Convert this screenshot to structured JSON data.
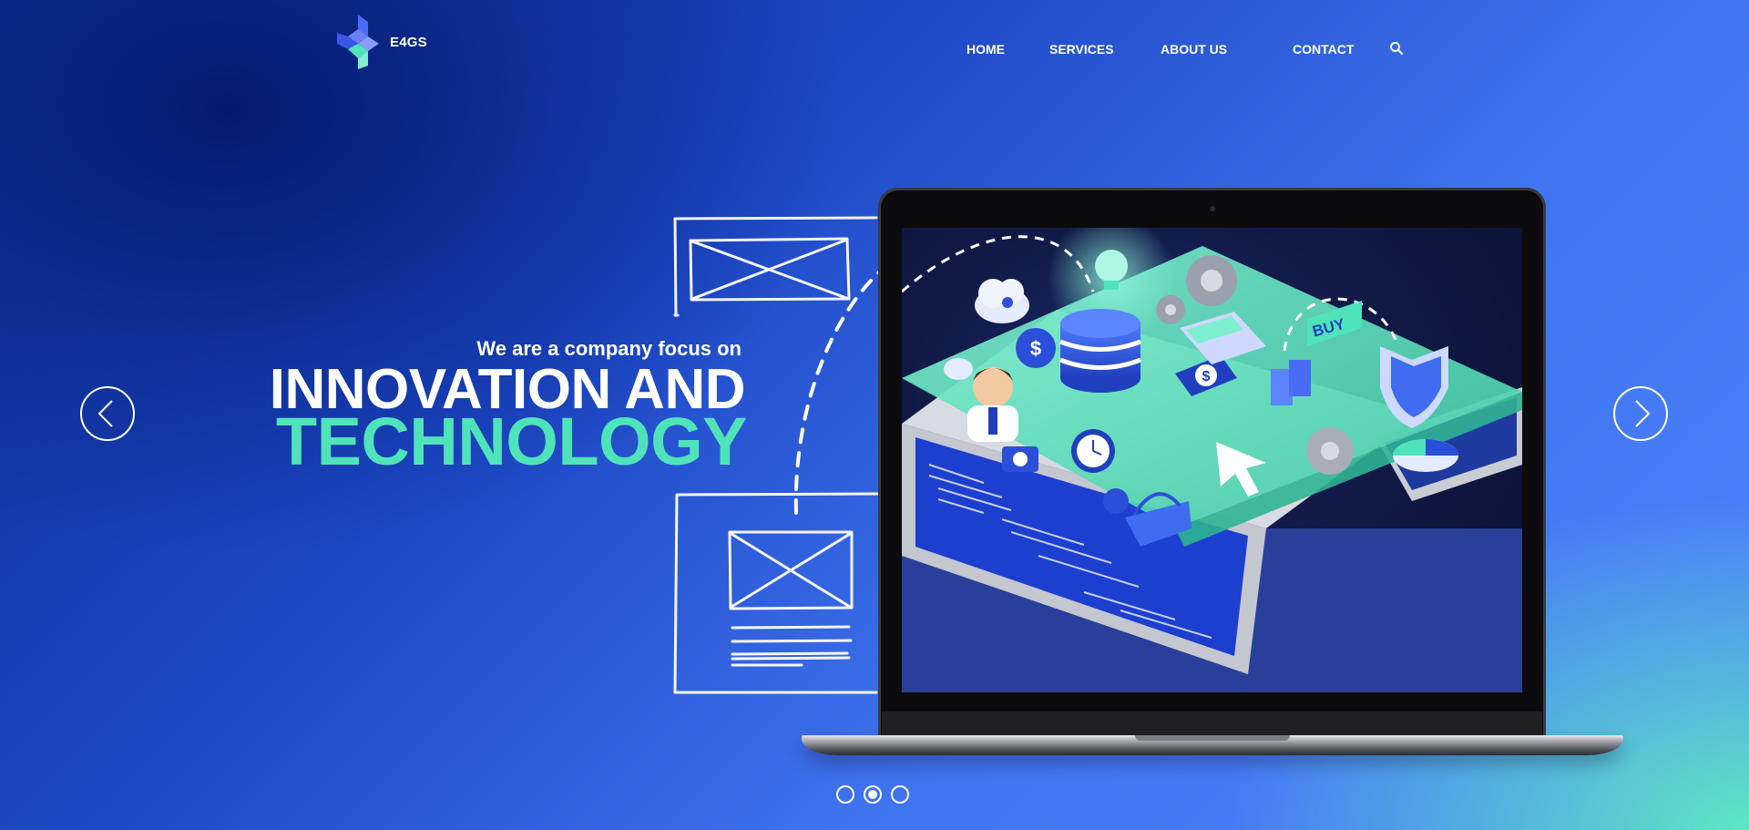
{
  "brand": {
    "name": "E4GS",
    "logo_icon": "cube-logo-icon",
    "logo_colors": [
      "#4a6cf5",
      "#7b8cff",
      "#4fe3b9"
    ]
  },
  "nav": {
    "items": [
      {
        "label": "HOME"
      },
      {
        "label": "SERVICES"
      },
      {
        "label": "ABOUT US"
      },
      {
        "label": "CONTACT"
      }
    ],
    "search_icon": "search-icon"
  },
  "hero": {
    "subtitle": "We are a company focus on",
    "title_line1": "INNOVATION AND",
    "title_line2": "TECHNOLOGY",
    "accent_color": "#4fe3b9"
  },
  "screen_art": {
    "buy_badge": "BUY",
    "currency_symbol": "$"
  },
  "slider": {
    "prev_icon": "chevron-left-icon",
    "next_icon": "chevron-right-icon",
    "total_slides": 3,
    "active_slide": 2
  },
  "colors": {
    "bg_dark": "#0a2a8c",
    "bg_mid": "#3f73ef",
    "bg_teal": "#5ee6c2",
    "text": "#ffffff"
  }
}
